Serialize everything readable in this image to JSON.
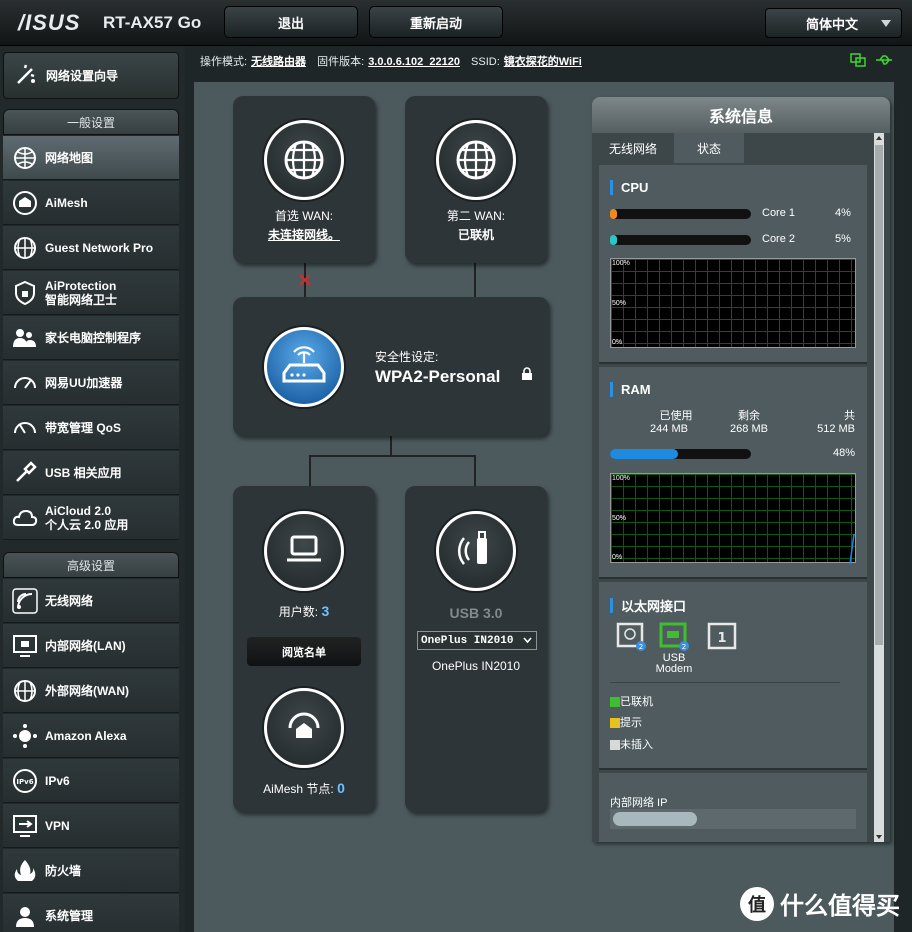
{
  "header": {
    "brand": "/ISUS",
    "model": "RT-AX57 Go",
    "logout_label": "退出",
    "reboot_label": "重新启动",
    "language": "简体中文"
  },
  "info": {
    "mode_key": "操作模式:",
    "mode_value": "无线路由器",
    "firmware_key": "固件版本:",
    "firmware_value": "3.0.0.6.102_22120",
    "ssid_key": "SSID:",
    "ssid_value": "镜衣探花的WiFi"
  },
  "sidebar": {
    "wizard_label": "网络设置向导",
    "general_head": "一般设置",
    "general_items": [
      {
        "label": "网络地图",
        "icon": "network-map-icon"
      },
      {
        "label": "AiMesh",
        "icon": "aimesh-icon"
      },
      {
        "label": "Guest Network Pro",
        "icon": "guest-network-icon"
      },
      {
        "label": "AiProtection",
        "label2": "智能网络卫士",
        "icon": "shield-icon"
      },
      {
        "label": "家长电脑控制程序",
        "icon": "parental-control-icon"
      },
      {
        "label": "网易UU加速器",
        "icon": "gauge-icon"
      },
      {
        "label": "带宽管理 QoS",
        "icon": "qos-icon"
      },
      {
        "label": "USB 相关应用",
        "icon": "usb-icon"
      },
      {
        "label": "AiCloud 2.0",
        "label2": "个人云 2.0 应用",
        "icon": "cloud-icon"
      }
    ],
    "advanced_head": "高级设置",
    "advanced_items": [
      {
        "label": "无线网络",
        "icon": "wireless-icon"
      },
      {
        "label": "内部网络(LAN)",
        "icon": "lan-icon"
      },
      {
        "label": "外部网络(WAN)",
        "icon": "wan-globe-icon"
      },
      {
        "label": "Amazon Alexa",
        "icon": "alexa-icon"
      },
      {
        "label": "IPv6",
        "icon": "ipv6-icon"
      },
      {
        "label": "VPN",
        "icon": "vpn-icon"
      },
      {
        "label": "防火墙",
        "icon": "firewall-icon"
      },
      {
        "label": "系统管理",
        "icon": "admin-icon"
      }
    ]
  },
  "map": {
    "wan1_title": "首选 WAN:",
    "wan1_status": "未连接网线。",
    "wan2_title": "第二 WAN:",
    "wan2_status": "已联机",
    "security_label": "安全性设定:",
    "security_value": "WPA2-Personal",
    "clients_label": "用户数:",
    "clients_count": "3",
    "client_list_button": "阅览名单",
    "aimesh_label": "AiMesh 节点:",
    "aimesh_count": "0",
    "usb_title": "USB 3.0",
    "usb_device_select": "OnePlus IN2010",
    "usb_device_name": "OnePlus IN2010"
  },
  "system": {
    "title": "系统信息",
    "tab_wireless": "无线网络",
    "tab_status": "状态",
    "cpu_head": "CPU",
    "cores": [
      {
        "label": "Core 1",
        "value": "4%",
        "fraction": 0.04,
        "color": "#f08a1e"
      },
      {
        "label": "Core 2",
        "value": "5%",
        "fraction": 0.05,
        "color": "#2ac7c7"
      }
    ],
    "graph_labels": [
      "100%",
      "50%",
      "0%"
    ],
    "ram_head": "RAM",
    "ram_used_label": "已使用",
    "ram_used": "244 MB",
    "ram_free_label": "剩余",
    "ram_free": "268 MB",
    "ram_total_label": "共",
    "ram_total": "512 MB",
    "ram_percent": "48%",
    "ram_fraction": 0.48,
    "eth_head": "以太网接口",
    "usb_modem_label": "USB",
    "usb_modem_label2": "Modem",
    "legend": [
      {
        "label": "已联机",
        "color": "#3fbf2f"
      },
      {
        "label": "提示",
        "color": "#e6c31c"
      },
      {
        "label": "未插入",
        "color": "#d8d8d8"
      }
    ],
    "lan_ip_label": "内部网络 IP"
  },
  "watermark": {
    "circle": "值",
    "text": "什么值得买"
  }
}
